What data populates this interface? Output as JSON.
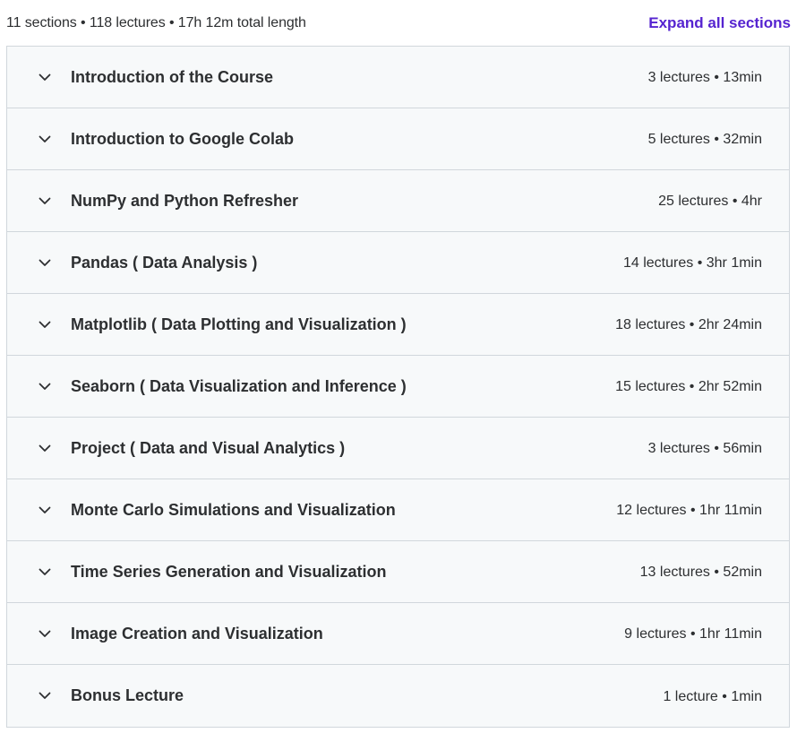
{
  "summary": {
    "text": "11 sections • 118 lectures • 17h 12m total length",
    "expand_label": "Expand all sections"
  },
  "colors": {
    "accent": "#5624d0",
    "section_bg": "#f7f9fa",
    "border": "#d1d7dc",
    "text": "#2d2f31"
  },
  "sections": [
    {
      "title": "Introduction of the Course",
      "meta": "3 lectures • 13min",
      "icon": "chevron-down-icon"
    },
    {
      "title": "Introduction to Google Colab",
      "meta": "5 lectures • 32min",
      "icon": "chevron-down-icon"
    },
    {
      "title": "NumPy and Python Refresher",
      "meta": "25 lectures • 4hr",
      "icon": "chevron-down-icon"
    },
    {
      "title": "Pandas ( Data Analysis )",
      "meta": "14 lectures • 3hr 1min",
      "icon": "chevron-down-icon"
    },
    {
      "title": "Matplotlib ( Data Plotting and Visualization )",
      "meta": "18 lectures • 2hr 24min",
      "icon": "chevron-down-icon"
    },
    {
      "title": "Seaborn ( Data Visualization and Inference )",
      "meta": "15 lectures • 2hr 52min",
      "icon": "chevron-down-icon"
    },
    {
      "title": "Project ( Data and Visual Analytics )",
      "meta": "3 lectures • 56min",
      "icon": "chevron-down-icon"
    },
    {
      "title": "Monte Carlo Simulations and Visualization",
      "meta": "12 lectures • 1hr 11min",
      "icon": "chevron-down-icon"
    },
    {
      "title": "Time Series Generation and Visualization",
      "meta": "13 lectures • 52min",
      "icon": "chevron-down-icon"
    },
    {
      "title": "Image Creation and Visualization",
      "meta": "9 lectures • 1hr 11min",
      "icon": "chevron-down-icon"
    },
    {
      "title": "Bonus Lecture",
      "meta": "1 lecture • 1min",
      "icon": "chevron-down-icon"
    }
  ]
}
